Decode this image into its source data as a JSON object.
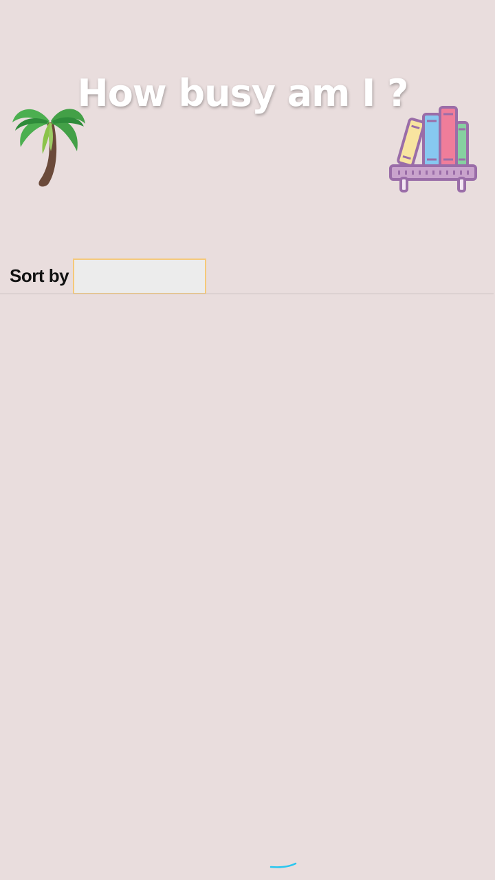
{
  "header": {
    "title": "How busy am I ?"
  },
  "icons": {
    "left": "palm-tree-icon",
    "right": "bookshelf-icon",
    "scroll": "refresh-indicator-icon"
  },
  "sort": {
    "label": "Sort by",
    "selected_value": ""
  },
  "colors": {
    "background": "#e9dddd",
    "title_text": "#ffffff",
    "select_border": "#f5c97a",
    "select_fill": "#ececec",
    "accent": "#29c6ef"
  }
}
